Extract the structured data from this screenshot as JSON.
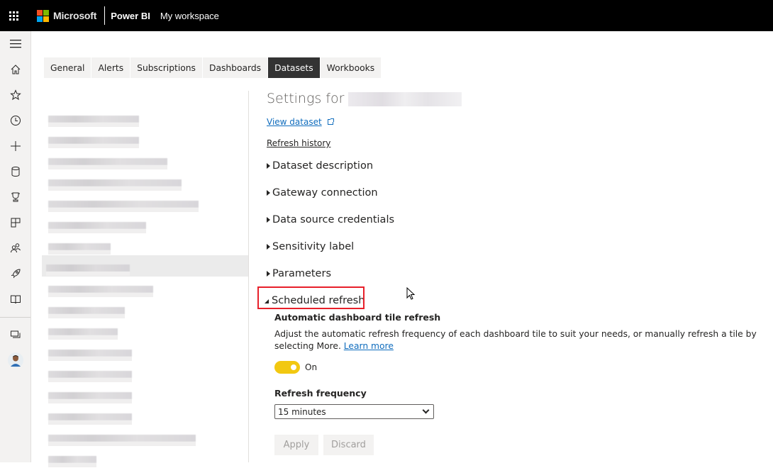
{
  "topbar": {
    "brand": "Microsoft",
    "product": "Power BI",
    "workspace": "My workspace",
    "logo_colors": [
      "#f25022",
      "#7fba00",
      "#00a4ef",
      "#ffb900"
    ]
  },
  "leftnav": {
    "items": [
      {
        "icon": "hamburger-icon"
      },
      {
        "icon": "home-icon"
      },
      {
        "icon": "star-icon"
      },
      {
        "icon": "clock-icon"
      },
      {
        "icon": "plus-icon"
      },
      {
        "icon": "database-icon"
      },
      {
        "icon": "trophy-icon"
      },
      {
        "icon": "apps-icon"
      },
      {
        "icon": "people-icon"
      },
      {
        "icon": "rocket-icon"
      },
      {
        "icon": "book-icon"
      },
      {
        "icon": "workspaces-icon"
      },
      {
        "icon": "avatar"
      }
    ]
  },
  "tabs": [
    {
      "label": "General",
      "active": false
    },
    {
      "label": "Alerts",
      "active": false
    },
    {
      "label": "Subscriptions",
      "active": false
    },
    {
      "label": "Dashboards",
      "active": false
    },
    {
      "label": "Datasets",
      "active": true
    },
    {
      "label": "Workbooks",
      "active": false
    }
  ],
  "dataset_list": {
    "note": "dataset names redacted (pixelated)",
    "count": 17,
    "selected_index": 7
  },
  "settings": {
    "title_prefix": "Settings for",
    "view_dataset": "View dataset",
    "refresh_history": "Refresh history",
    "sections": [
      {
        "label": "Dataset description",
        "expanded": false
      },
      {
        "label": "Gateway connection",
        "expanded": false
      },
      {
        "label": "Data source credentials",
        "expanded": false
      },
      {
        "label": "Sensitivity label",
        "expanded": false
      },
      {
        "label": "Parameters",
        "expanded": false
      },
      {
        "label": "Scheduled refresh",
        "expanded": true
      }
    ],
    "scheduled_refresh": {
      "subtitle": "Automatic dashboard tile refresh",
      "description": "Adjust the automatic refresh frequency of each dashboard tile to suit your needs, or manually refresh a tile by selecting More.",
      "learn_more": "Learn more",
      "toggle_state": "On",
      "toggle_color": "#f2c811",
      "frequency_label": "Refresh frequency",
      "frequency_value": "15 minutes",
      "apply": "Apply",
      "discard": "Discard"
    }
  },
  "highlight_color": "#e8202a"
}
